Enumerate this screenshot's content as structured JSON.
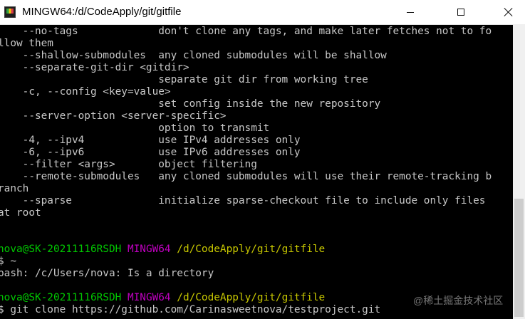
{
  "window": {
    "title": "MINGW64:/d/CodeApply/git/gitfile",
    "controls": [
      "minimize-icon",
      "maximize-icon",
      "close-icon"
    ]
  },
  "terminal": {
    "lines": [
      "    --no-tags             don't clone any tags, and make later fetches not to fo",
      "llow them",
      "    --shallow-submodules  any cloned submodules will be shallow",
      "    --separate-git-dir <gitdir>",
      "                          separate git dir from working tree",
      "    -c, --config <key=value>",
      "                          set config inside the new repository",
      "    --server-option <server-specific>",
      "                          option to transmit",
      "    -4, --ipv4            use IPv4 addresses only",
      "    -6, --ipv6            use IPv6 addresses only",
      "    --filter <args>       object filtering",
      "    --remote-submodules   any cloned submodules will use their remote-tracking b",
      "ranch",
      "    --sparse              initialize sparse-checkout file to include only files",
      "at root"
    ],
    "prompt1": {
      "user_host": "nova@SK-20211116RSDH",
      "system": "MINGW64",
      "path": "/d/CodeApply/git/gitfile"
    },
    "command1": "$ ~",
    "output1": "bash: /c/Users/nova: Is a directory",
    "prompt2": {
      "user_host": "nova@SK-20211116RSDH",
      "system": "MINGW64",
      "path": "/d/CodeApply/git/gitfile"
    },
    "command2": "$ git clone https://github.com/Carinasweetnova/testproject.git"
  },
  "watermark": "@稀土掘金技术社区",
  "colors": {
    "background": "#000000",
    "text": "#c7c7c7",
    "user_host": "#00c800",
    "system": "#c000c0",
    "path": "#c8c800"
  }
}
